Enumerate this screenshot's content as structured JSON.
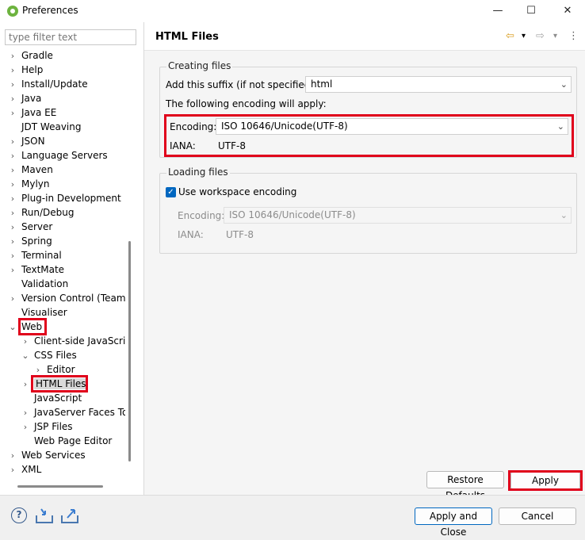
{
  "window": {
    "title": "Preferences",
    "minimize": "—",
    "maximize": "☐",
    "close": "✕"
  },
  "filter": {
    "placeholder": "type filter text"
  },
  "tree": [
    {
      "label": "Gradle",
      "twisty": "›"
    },
    {
      "label": "Help",
      "twisty": "›"
    },
    {
      "label": "Install/Update",
      "twisty": "›"
    },
    {
      "label": "Java",
      "twisty": "›"
    },
    {
      "label": "Java EE",
      "twisty": "›"
    },
    {
      "label": "JDT Weaving",
      "twisty": ""
    },
    {
      "label": "JSON",
      "twisty": "›"
    },
    {
      "label": "Language Servers",
      "twisty": "›"
    },
    {
      "label": "Maven",
      "twisty": "›"
    },
    {
      "label": "Mylyn",
      "twisty": "›"
    },
    {
      "label": "Plug-in Development",
      "twisty": "›"
    },
    {
      "label": "Run/Debug",
      "twisty": "›"
    },
    {
      "label": "Server",
      "twisty": "›"
    },
    {
      "label": "Spring",
      "twisty": "›"
    },
    {
      "label": "Terminal",
      "twisty": "›"
    },
    {
      "label": "TextMate",
      "twisty": "›"
    },
    {
      "label": "Validation",
      "twisty": ""
    },
    {
      "label": "Version Control (Team)",
      "twisty": "›"
    },
    {
      "label": "Visualiser",
      "twisty": ""
    },
    {
      "label": "Web",
      "twisty": "⌄",
      "expanded": true
    },
    {
      "label": "Client-side JavaScript",
      "twisty": "›"
    },
    {
      "label": "CSS Files",
      "twisty": "⌄",
      "expanded": true
    },
    {
      "label": "Editor",
      "twisty": "›"
    },
    {
      "label": "HTML Files",
      "twisty": "›",
      "selected": true
    },
    {
      "label": "JavaScript",
      "twisty": ""
    },
    {
      "label": "JavaServer Faces Tools",
      "twisty": "›"
    },
    {
      "label": "JSP Files",
      "twisty": "›"
    },
    {
      "label": "Web Page Editor",
      "twisty": ""
    },
    {
      "label": "Web Services",
      "twisty": "›"
    },
    {
      "label": "XML",
      "twisty": "›"
    }
  ],
  "page": {
    "title": "HTML Files",
    "nav_back": "⇦",
    "nav_forward": "⇨",
    "menu": "⋮",
    "dropdown": "▾",
    "creating": {
      "legend": "Creating files",
      "suffix_label": "Add this suffix (if not specified):",
      "suffix_value": "html",
      "encoding_note": "The following encoding will apply:",
      "encoding_label": "Encoding:",
      "encoding_value": "ISO 10646/Unicode(UTF-8)",
      "iana_label": "IANA:",
      "iana_value": "UTF-8"
    },
    "loading": {
      "legend": "Loading files",
      "workspace_label": "Use workspace encoding",
      "workspace_checked": true,
      "encoding_label": "Encoding:",
      "encoding_value": "ISO 10646/Unicode(UTF-8)",
      "iana_label": "IANA:",
      "iana_value": "UTF-8"
    },
    "restore_defaults": "Restore Defaults",
    "apply": "Apply"
  },
  "footer": {
    "help": "?",
    "apply_and_close": "Apply and Close",
    "cancel": "Cancel"
  },
  "colors": {
    "highlight": "#e0001b",
    "accent": "#0067c0"
  }
}
